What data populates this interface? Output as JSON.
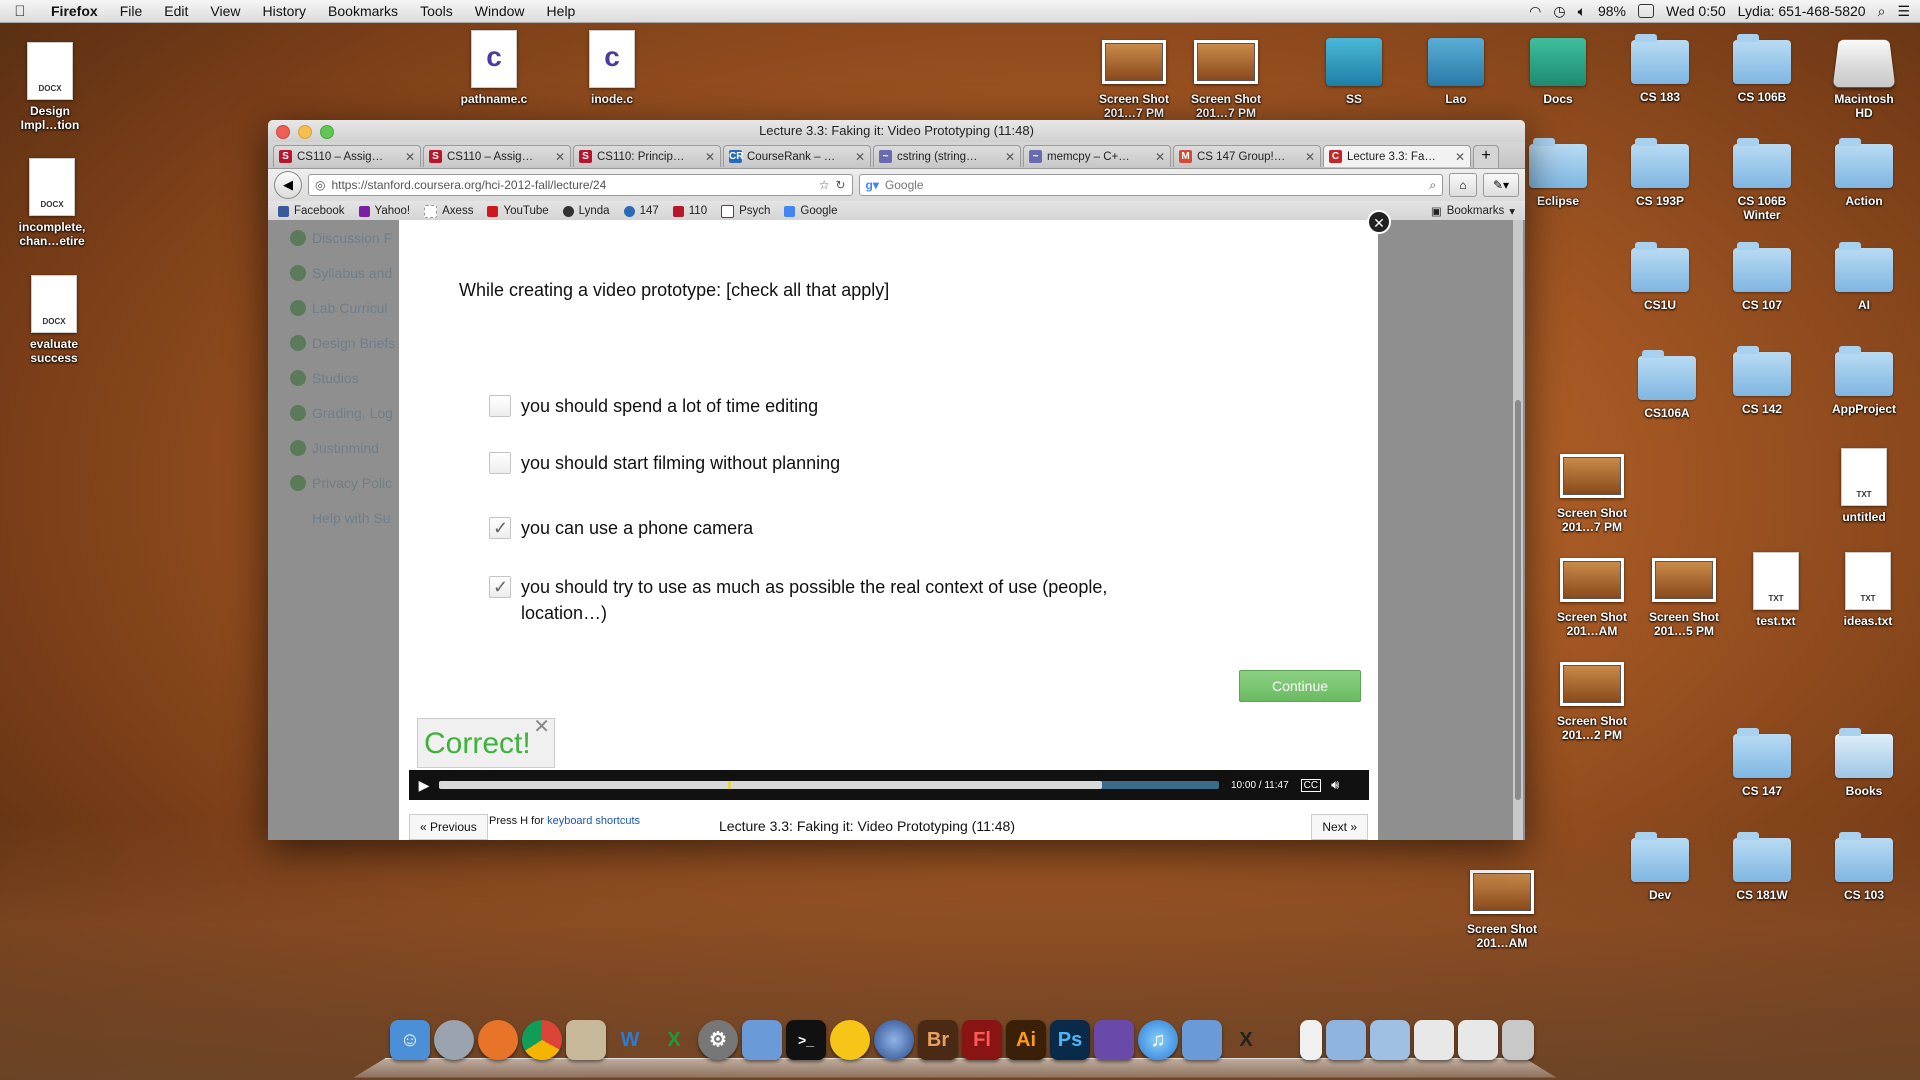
{
  "menubar": {
    "app_name": "Firefox",
    "menus": [
      "File",
      "Edit",
      "View",
      "History",
      "Bookmarks",
      "Tools",
      "Window",
      "Help"
    ],
    "battery": "98%",
    "clock": "Wed 0:50",
    "user": "Lydia: 651-468-5820"
  },
  "desktop_left": [
    {
      "label": "Design\nImpl…tion",
      "kind": "DOCX"
    },
    {
      "label": "incomplete,\nchan…etire",
      "kind": "DOCX"
    },
    {
      "label": "evaluate\nsuccess",
      "kind": "DOCX"
    }
  ],
  "desktop_top": [
    {
      "label": "pathname.c"
    },
    {
      "label": "inode.c"
    }
  ],
  "desktop_right": {
    "row1": [
      "Screen Shot\n201…7 PM",
      "Screen Shot\n201…7 PM",
      "SS",
      "Lao",
      "Docs",
      "CS 183",
      "CS 106B",
      "Macintosh\nHD"
    ],
    "folders": [
      "Eclipse",
      "CS 193P",
      "CS 106B\nWinter",
      "Action",
      "CS1U",
      "CS 107",
      "AI",
      "CS106A",
      "CS 142",
      "AppProject",
      "CS 147",
      "Books",
      "Dev",
      "CS 181W",
      "CS 103"
    ],
    "files": [
      "Screen Shot\n201…7 PM",
      "untitled",
      "Screen Shot\n201…AM",
      "Screen Shot\n201…5 PM",
      "test.txt",
      "ideas.txt",
      "Screen Shot\n201…2 PM",
      "Screen Shot\n201…AM"
    ],
    "file_kind_txt": "TXT"
  },
  "window": {
    "title": "Lecture 3.3: Faking it: Video Prototyping (11:48)",
    "tabs": [
      {
        "label": "CS110 – Assig…",
        "fav": "S",
        "color": "#b7162d"
      },
      {
        "label": "CS110 – Assig…",
        "fav": "S",
        "color": "#b7162d"
      },
      {
        "label": "CS110: Princip…",
        "fav": "S",
        "color": "#b7162d"
      },
      {
        "label": "CourseRank – …",
        "fav": "CR",
        "color": "#2a6ab8"
      },
      {
        "label": "cstring (string…",
        "fav": "~",
        "color": "#6a6ab0"
      },
      {
        "label": "memcpy – C+…",
        "fav": "~",
        "color": "#6a6ab0"
      },
      {
        "label": "CS 147 Group!…",
        "fav": "M",
        "color": "#d44a3a"
      },
      {
        "label": "Lecture 3.3: Fa…",
        "fav": "C",
        "color": "#c0282a"
      }
    ],
    "url": "https://stanford.coursera.org/hci-2012-fall/lecture/24",
    "search_placeholder": "Google",
    "bookmarks": [
      {
        "label": "Facebook",
        "color": "#3b5998"
      },
      {
        "label": "Yahoo!",
        "color": "#7b1fa2"
      },
      {
        "label": "Axess",
        "color": "#999999"
      },
      {
        "label": "YouTube",
        "color": "#cc181e"
      },
      {
        "label": "Lynda",
        "color": "#333333"
      },
      {
        "label": "147",
        "color": "#2a6ab8"
      },
      {
        "label": "110",
        "color": "#b7162d"
      },
      {
        "label": "Psych",
        "color": "#b7162d"
      },
      {
        "label": "Google",
        "color": "#4285f4"
      }
    ],
    "bookmarks_menu": "Bookmarks"
  },
  "sidebar": [
    "Discussion F",
    "Syllabus and",
    "Lab Curricul",
    "Design Briefs",
    "Studios",
    "Grading, Log",
    "Justinmind",
    "Privacy Polic",
    "Help with Su"
  ],
  "quiz": {
    "question": "While creating a video prototype: [check all that apply]",
    "options": [
      {
        "text": "you should spend a lot of time editing",
        "checked": false
      },
      {
        "text": "you should start filming without planning",
        "checked": false
      },
      {
        "text": "you can use a phone camera",
        "checked": true
      },
      {
        "text": "you should try to use as much as possible the real context of use (people, location…)",
        "checked": true
      }
    ],
    "continue_label": "Continue",
    "feedback": "Correct!"
  },
  "player": {
    "time": "10:00 / 11:47",
    "progress": 0.85,
    "marker": 0.37,
    "cc_label": "CC"
  },
  "footer": {
    "previous": "« Previous",
    "next": "Next »",
    "kbd_prefix": "Press H for ",
    "kbd_link": "keyboard shortcuts",
    "lecture_title": "Lecture 3.3: Faking it: Video Prototyping (11:48)"
  }
}
